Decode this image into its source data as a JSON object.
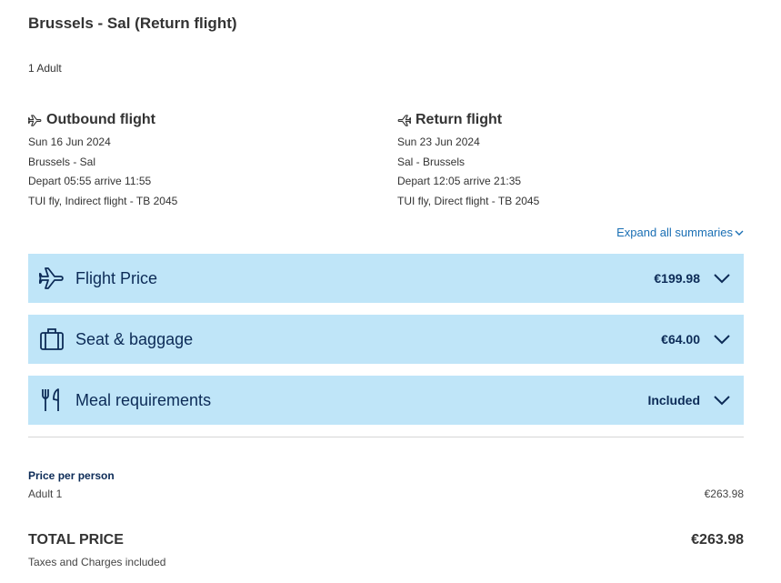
{
  "header": {
    "title": "Brussels - Sal (Return flight)",
    "passengers": "1 Adult"
  },
  "outbound": {
    "label": "Outbound flight",
    "icon": "plane-takeoff-icon",
    "date": "Sun 16 Jun 2024",
    "route": "Brussels - Sal",
    "times": "Depart 05:55 arrive 11:55",
    "carrier": "TUI fly, Indirect flight - TB 2045"
  },
  "return": {
    "label": "Return flight",
    "icon": "plane-landing-icon",
    "date": "Sun 23 Jun 2024",
    "route": "Sal - Brussels",
    "times": "Depart 12:05 arrive 21:35",
    "carrier": "TUI fly, Direct flight - TB 2045"
  },
  "expand_all": "Expand all summaries",
  "panels": [
    {
      "label": "Flight Price",
      "value": "€199.98",
      "icon": "airplane-icon"
    },
    {
      "label": "Seat & baggage",
      "value": "€64.00",
      "icon": "suitcase-icon"
    },
    {
      "label": "Meal requirements",
      "value": "Included",
      "icon": "fork-knife-icon"
    }
  ],
  "price_per_person": {
    "heading": "Price per person",
    "rows": [
      {
        "label": "Adult 1",
        "value": "€263.98"
      }
    ]
  },
  "total": {
    "label": "TOTAL PRICE",
    "value": "€263.98",
    "note": "Taxes and Charges included"
  },
  "colors": {
    "panel_bg": "#bfe5f8",
    "navy": "#0c2b57",
    "link": "#1a6fb4",
    "text": "#333333"
  }
}
